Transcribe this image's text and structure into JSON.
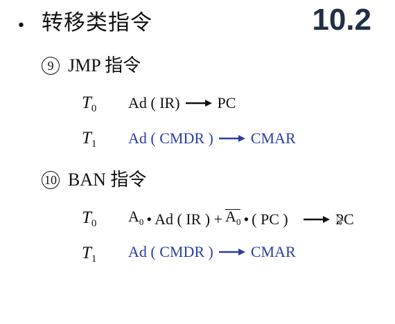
{
  "slide": {
    "bullet": "•",
    "title": "转移类指令",
    "section_number": "10.2"
  },
  "jmp": {
    "number": "9",
    "heading": "JMP 指令",
    "steps": [
      {
        "t": "T",
        "t_sub": "0",
        "left": "Ad ( IR)",
        "right": "PC",
        "color": "#111111"
      },
      {
        "t": "T",
        "t_sub": "1",
        "left": "Ad ( CMDR )",
        "right": "CMAR",
        "color": "#2a3fa0"
      }
    ]
  },
  "ban": {
    "number": "10",
    "heading": "BAN 指令",
    "step0": {
      "t": "T",
      "t_sub": "0",
      "a": "A",
      "a_sub": "0",
      "dot": "•",
      "mid": "Ad ( IR ) +",
      "a_bar": "A",
      "a_bar_sub": "0",
      "tail": "( PC )",
      "right": "PC"
    },
    "step1": {
      "t": "T",
      "t_sub": "1",
      "left": "Ad ( CMDR )",
      "right": "CMAR"
    }
  },
  "colors": {
    "black_text": "#111111",
    "blue_text": "#2a3fa0",
    "section_number": "#1f2f45"
  },
  "icons": {
    "arrow": "right-arrow-icon",
    "cursor": "mouse-pointer-icon"
  }
}
